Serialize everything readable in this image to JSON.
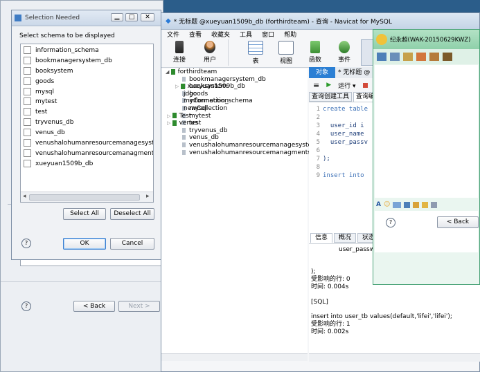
{
  "selection_dialog": {
    "title": "Selection Needed",
    "prompt": "Select schema to be displayed",
    "schemas": [
      "information_schema",
      "bookmanagersystem_db",
      "booksystem",
      "goods",
      "mysql",
      "mytest",
      "test",
      "tryvenus_db",
      "venus_db",
      "venushalohumanresourcemanagesystem",
      "venushalohumanresourcemanagmentsy",
      "xueyuan1509b_db"
    ],
    "select_all": "Select All",
    "deselect_all": "Deselect All",
    "ok": "OK",
    "cancel": "Cancel",
    "help": "?"
  },
  "wizard": {
    "back": "< Back",
    "next": "Next >",
    "help": "?"
  },
  "navicat": {
    "title": "* 无标题 @xueyuan1509b_db (forthirdteam) - 查询 - Navicat for MySQL",
    "menu": [
      "文件",
      "查看",
      "收藏夹",
      "工具",
      "窗口",
      "帮助"
    ],
    "toolbar": [
      {
        "label": "连接",
        "icon": "plug-icon"
      },
      {
        "label": "用户",
        "icon": "user-icon"
      },
      {
        "label": "表",
        "icon": "table-icon"
      },
      {
        "label": "视图",
        "icon": "view-icon"
      },
      {
        "label": "函数",
        "icon": "function-icon"
      },
      {
        "label": "事件",
        "icon": "event-icon"
      }
    ],
    "tree": {
      "connection": "forthirdteam",
      "databases": [
        "bookmanagersystem_db",
        "booksystem",
        "goods",
        "information_schema",
        "mysql",
        "mytest",
        "test",
        "tryvenus_db",
        "venus_db",
        "venushalohumanresourcemanagesyste",
        "venushalohumanresourcemanagmentsy"
      ],
      "selected_db": "xueyuan1509b_db",
      "others": [
        "jdbc",
        "myConnection",
        "newCollection"
      ],
      "bottom": [
        "Test",
        "venus"
      ]
    },
    "tabs": {
      "objects": "对象",
      "query_tab": "* 无标题 @"
    },
    "subtabs": [
      "查询创建工具",
      "查询编辑"
    ],
    "run": "运行 ▾",
    "code": [
      {
        "n": "1",
        "t": "create table"
      },
      {
        "n": "2",
        "t": ""
      },
      {
        "n": "3",
        "t": "  user_id i"
      },
      {
        "n": "4",
        "t": "  user_name"
      },
      {
        "n": "5",
        "t": "  user_passv"
      },
      {
        "n": "6",
        "t": ""
      },
      {
        "n": "7",
        "t": ");"
      },
      {
        "n": "8",
        "t": ""
      },
      {
        "n": "9",
        "t": "insert into"
      }
    ],
    "result_tabs": [
      "信息",
      "概况",
      "状态"
    ],
    "messages": [
      "user_passw",
      "",
      "",
      ");",
      "受影响的行: 0",
      "时间: 0.004s",
      "",
      "[SQL]",
      "",
      "insert into user_tb values(default,'lifei','lifei');",
      "受影响的行: 1",
      "时间: 0.002s"
    ]
  },
  "chat": {
    "title": "纪永超(WAK-20150629KWZ)",
    "back": "< Back",
    "help": "?"
  }
}
